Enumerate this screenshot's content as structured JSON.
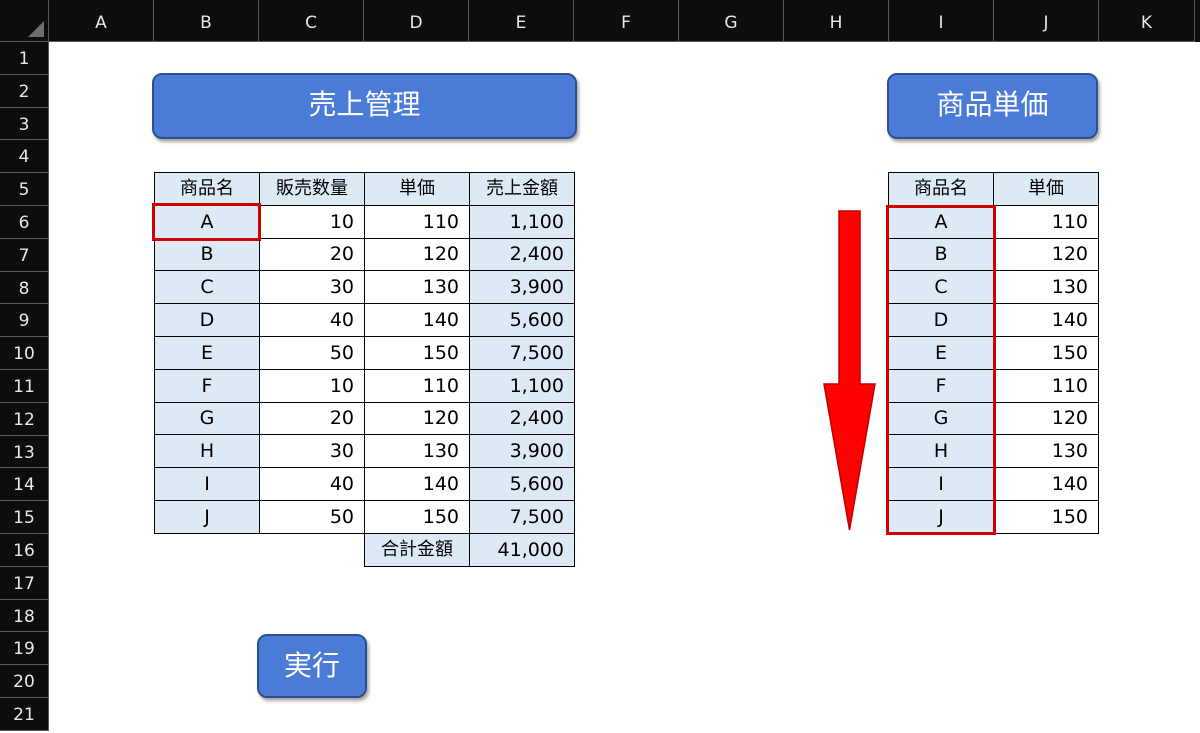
{
  "columns": [
    "A",
    "B",
    "C",
    "D",
    "E",
    "F",
    "G",
    "H",
    "I",
    "J",
    "K"
  ],
  "rows": [
    "1",
    "2",
    "3",
    "4",
    "5",
    "6",
    "7",
    "8",
    "9",
    "10",
    "11",
    "12",
    "13",
    "14",
    "15",
    "16",
    "17",
    "18",
    "19",
    "20",
    "21"
  ],
  "buttons": {
    "sales_title": "売上管理",
    "price_title": "商品単価",
    "execute": "実行"
  },
  "sales_table": {
    "headers": [
      "商品名",
      "販売数量",
      "単価",
      "売上金額"
    ],
    "rows": [
      {
        "name": "A",
        "qty": "10",
        "price": "110",
        "amount": "1,100"
      },
      {
        "name": "B",
        "qty": "20",
        "price": "120",
        "amount": "2,400"
      },
      {
        "name": "C",
        "qty": "30",
        "price": "130",
        "amount": "3,900"
      },
      {
        "name": "D",
        "qty": "40",
        "price": "140",
        "amount": "5,600"
      },
      {
        "name": "E",
        "qty": "50",
        "price": "150",
        "amount": "7,500"
      },
      {
        "name": "F",
        "qty": "10",
        "price": "110",
        "amount": "1,100"
      },
      {
        "name": "G",
        "qty": "20",
        "price": "120",
        "amount": "2,400"
      },
      {
        "name": "H",
        "qty": "30",
        "price": "130",
        "amount": "3,900"
      },
      {
        "name": "I",
        "qty": "40",
        "price": "140",
        "amount": "5,600"
      },
      {
        "name": "J",
        "qty": "50",
        "price": "150",
        "amount": "7,500"
      }
    ],
    "total_label": "合計金額",
    "total_value": "41,000"
  },
  "price_table": {
    "headers": [
      "商品名",
      "単価"
    ],
    "rows": [
      {
        "name": "A",
        "price": "110"
      },
      {
        "name": "B",
        "price": "120"
      },
      {
        "name": "C",
        "price": "130"
      },
      {
        "name": "D",
        "price": "140"
      },
      {
        "name": "E",
        "price": "150"
      },
      {
        "name": "F",
        "price": "110"
      },
      {
        "name": "G",
        "price": "120"
      },
      {
        "name": "H",
        "price": "130"
      },
      {
        "name": "I",
        "price": "140"
      },
      {
        "name": "J",
        "price": "150"
      }
    ]
  },
  "colors": {
    "header_bg": "#0d0d0d",
    "button_blue": "#4a7bd6",
    "cell_fill": "#dde9f5",
    "highlight_red": "#d00000"
  },
  "icons": {
    "arrow": "down-arrow-icon"
  }
}
